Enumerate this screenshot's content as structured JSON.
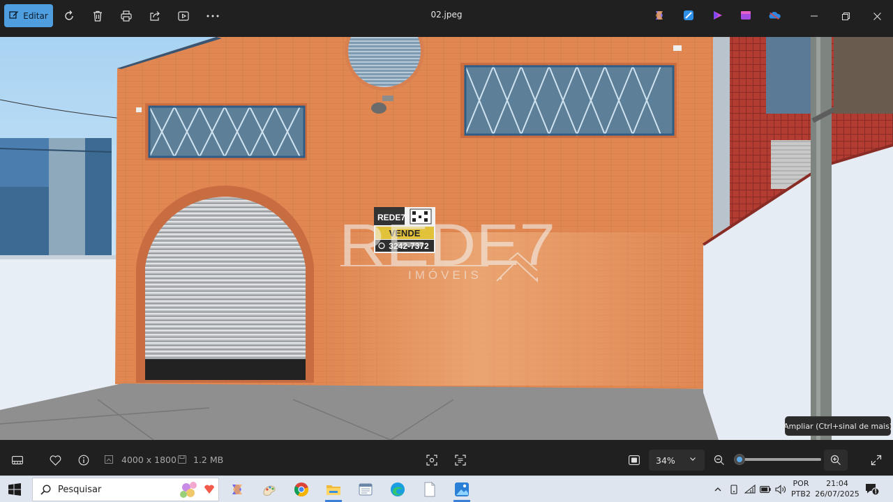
{
  "toolbar": {
    "edit_label": "Editar",
    "filename": "02.jpeg",
    "icons": [
      "edit-icon",
      "rotate-icon",
      "delete-icon",
      "print-icon",
      "share-icon",
      "slideshow-icon",
      "more-icon"
    ],
    "apps": [
      "copilot-icon",
      "designer-icon",
      "clipchamp-icon",
      "clipchamp-video-icon",
      "onedrive-icon"
    ],
    "window_buttons": [
      "minimize-icon",
      "restore-icon",
      "close-icon"
    ]
  },
  "photo": {
    "watermark_brand": "REDE7",
    "watermark_sub": "IMÓVEIS",
    "sign_brand": "REDE7",
    "sign_action": "VENDE",
    "sign_phone": "3242-7372"
  },
  "tooltip": {
    "text": "Ampliar (Ctrl+sinal de mais)"
  },
  "bottombar": {
    "dimensions": "4000 x 1800",
    "filesize": "1.2 MB",
    "zoom_value": "34%",
    "zoom_percent": 34
  },
  "taskbar": {
    "search_placeholder": "Pesquisar",
    "language_top": "POR",
    "language_bottom": "PTB2",
    "time": "21:04",
    "date": "26/07/2025",
    "apps": [
      "copilot-app",
      "paint-app",
      "chrome-app",
      "file-explorer-app",
      "notepad-app",
      "edge-app",
      "file-app",
      "photos-app"
    ]
  },
  "colors": {
    "accent": "#4f9fe0",
    "background": "#202020",
    "taskbar": "#dfe5ee",
    "wall": "#e08752"
  }
}
